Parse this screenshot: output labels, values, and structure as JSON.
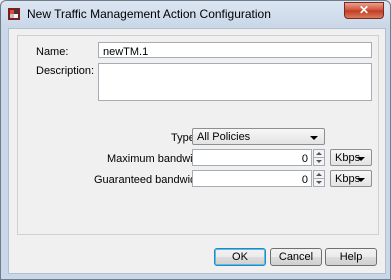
{
  "window": {
    "title": "New Traffic Management Action Configuration",
    "close_glyph": "✕"
  },
  "form": {
    "name_label": "Name:",
    "name_value": "newTM.1",
    "description_label": "Description:",
    "description_value": "",
    "type_label": "Type:",
    "type_value": "All Policies",
    "max_bw_label": "Maximum bandwidth:",
    "max_bw_value": "0",
    "max_bw_unit": "Kbps",
    "guar_bw_label": "Guaranteed bandwidth:",
    "guar_bw_value": "0",
    "guar_bw_unit": "Kbps"
  },
  "buttons": {
    "ok": "OK",
    "cancel": "Cancel",
    "help": "Help"
  },
  "colors": {
    "title_bar": "#c9d7e8",
    "close_button": "#c13a22",
    "default_button_border": "#3c7fb1"
  },
  "icons": {
    "app": "app-icon",
    "close": "close-icon",
    "dropdown": "chevron-down-icon",
    "spinner": "spinner-arrows-icon"
  }
}
